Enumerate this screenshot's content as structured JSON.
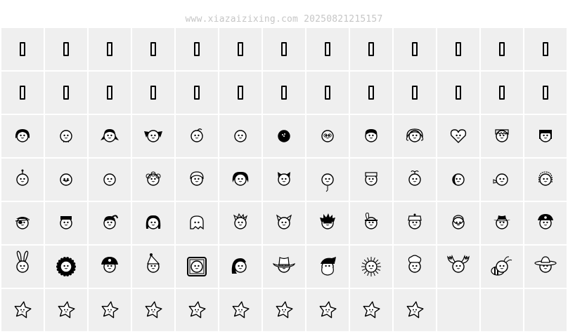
{
  "watermark": "www.xiazaizixing.com 20250821215157",
  "rows": [
    {
      "type": "notdef",
      "items": [
        "missing-glyph",
        "missing-glyph",
        "missing-glyph",
        "missing-glyph",
        "missing-glyph",
        "missing-glyph",
        "missing-glyph",
        "missing-glyph",
        "missing-glyph",
        "missing-glyph",
        "missing-glyph",
        "missing-glyph",
        "missing-glyph"
      ]
    },
    {
      "type": "notdef",
      "items": [
        "missing-glyph",
        "missing-glyph",
        "missing-glyph",
        "missing-glyph",
        "missing-glyph",
        "missing-glyph",
        "missing-glyph",
        "missing-glyph",
        "missing-glyph",
        "missing-glyph",
        "missing-glyph",
        "missing-glyph",
        "missing-glyph"
      ]
    },
    {
      "type": "face",
      "items": [
        "girl-dark-hair-face-icon",
        "plain-face-bowtie-icon",
        "girl-pigtails-face-icon",
        "dog-ears-face-icon",
        "face-with-curl-icon",
        "plain-round-face-icon",
        "bowling-ball-face-icon",
        "face-with-glasses-icon",
        "curly-hair-face-icon",
        "bonnet-face-icon",
        "heart-face-icon",
        "bangs-face-icon",
        "bob-hair-face-icon"
      ]
    },
    {
      "type": "face",
      "items": [
        "antenna-face-icon",
        "mustache-face-icon",
        "smiling-face-icon",
        "curly-wig-face-icon",
        "granny-face-icon",
        "afro-face-icon",
        "cat-face-icon",
        "balloon-face-icon",
        "cap-face-icon",
        "sprout-face-icon",
        "moon-face-icon",
        "face-with-tag-icon",
        "blonde-face-icon"
      ]
    },
    {
      "type": "face",
      "items": [
        "eyepatch-bandana-face-icon",
        "flat-top-face-icon",
        "ponytail-face-icon",
        "long-hair-girl-face-icon",
        "ghost-face-icon",
        "spiky-hair-face-icon",
        "devil-cat-face-icon",
        "punk-hair-face-icon",
        "feather-face-icon",
        "police-cap-face-icon",
        "egg-face-icon",
        "cowboy-hat-face-icon",
        "pirate-hat-face-icon"
      ]
    },
    {
      "type": "face",
      "items": [
        "bunny-face-icon",
        "lion-mane-face-icon",
        "pirate-skull-hat-face-icon",
        "elf-hat-face-icon",
        "framed-portrait-face-icon",
        "wavy-hair-face-icon",
        "big-cowboy-hat-face-icon",
        "santa-face-icon",
        "sun-face-icon",
        "chef-face-icon",
        "moose-face-icon",
        "bee-face-icon",
        "sombrero-face-icon"
      ]
    },
    {
      "type": "star",
      "items": [
        "star-face-icon",
        "star-face-icon",
        "star-face-icon",
        "star-face-icon",
        "star-face-icon",
        "star-face-icon",
        "star-face-icon",
        "star-face-icon",
        "star-face-icon",
        "star-face-icon"
      ]
    }
  ]
}
